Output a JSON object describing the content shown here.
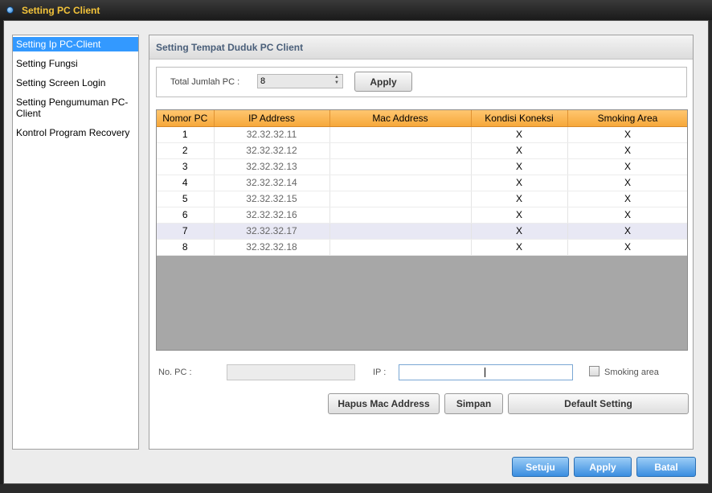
{
  "window": {
    "title": "Setting PC Client"
  },
  "sidebar": {
    "items": [
      {
        "label": "Setting Ip PC-Client"
      },
      {
        "label": "Setting Fungsi"
      },
      {
        "label": "Setting Screen Login"
      },
      {
        "label": "Setting Pengumuman PC-Client"
      },
      {
        "label": "Kontrol Program Recovery"
      }
    ]
  },
  "panel": {
    "title": "Setting Tempat Duduk PC Client",
    "total_label": "Total Jumlah PC :",
    "total_value": "8",
    "apply_label": "Apply"
  },
  "table": {
    "columns": [
      "Nomor PC",
      "IP Address",
      "Mac Address",
      "Kondisi Koneksi",
      "Smoking Area"
    ],
    "rows": [
      [
        "1",
        "32.32.32.11",
        "",
        "X",
        "X"
      ],
      [
        "2",
        "32.32.32.12",
        "",
        "X",
        "X"
      ],
      [
        "3",
        "32.32.32.13",
        "",
        "X",
        "X"
      ],
      [
        "4",
        "32.32.32.14",
        "",
        "X",
        "X"
      ],
      [
        "5",
        "32.32.32.15",
        "",
        "X",
        "X"
      ],
      [
        "6",
        "32.32.32.16",
        "",
        "X",
        "X"
      ],
      [
        "7",
        "32.32.32.17",
        "",
        "X",
        "X"
      ],
      [
        "8",
        "32.32.32.18",
        "",
        "X",
        "X"
      ]
    ]
  },
  "form": {
    "no_pc_label": "No. PC :",
    "no_pc_value": "",
    "ip_label": "IP :",
    "ip_value": "",
    "smoking_label": "Smoking area",
    "hapus_label": "Hapus Mac Address",
    "simpan_label": "Simpan",
    "default_label": "Default Setting"
  },
  "footer": {
    "setuju_label": "Setuju",
    "apply_label": "Apply",
    "batal_label": "Batal"
  }
}
